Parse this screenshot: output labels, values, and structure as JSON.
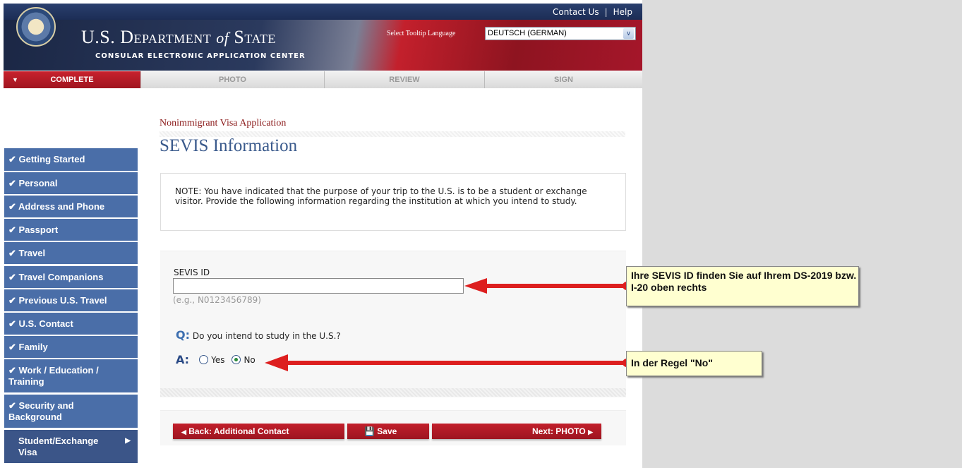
{
  "header": {
    "contact": "Contact Us",
    "help": "Help",
    "title_main": "U.S. Department",
    "title_of": "of",
    "title_state": "State",
    "subtitle": "CONSULAR ELECTRONIC APPLICATION CENTER",
    "lang_label": "Select Tooltip Language",
    "lang_value": "DEUTSCH (GERMAN)"
  },
  "nav": [
    {
      "label": "COMPLETE"
    },
    {
      "label": "PHOTO"
    },
    {
      "label": "REVIEW"
    },
    {
      "label": "SIGN"
    }
  ],
  "breadcrumb": "Nonimmigrant Visa Application",
  "page_title": "SEVIS Information",
  "sidebar": {
    "items": [
      {
        "label": "Getting Started"
      },
      {
        "label": "Personal"
      },
      {
        "label": "Address and Phone"
      },
      {
        "label": "Passport"
      },
      {
        "label": "Travel"
      },
      {
        "label": "Travel Companions"
      },
      {
        "label": "Previous U.S. Travel"
      },
      {
        "label": "U.S. Contact"
      },
      {
        "label": "Family"
      },
      {
        "label": "Work / Education / Training"
      },
      {
        "label": "Security and Background"
      },
      {
        "label": "Student/Exchange Visa"
      }
    ]
  },
  "note": "NOTE: You have indicated that the purpose of your trip to the U.S. is to be a student or exchange visitor. Provide the following information regarding the institution at which you intend to study.",
  "form": {
    "sevis_label": "SEVIS ID",
    "sevis_value": "",
    "sevis_hint": "(e.g., N0123456789)",
    "q_prefix": "Q:",
    "question": "Do you intend to study in the U.S.?",
    "a_prefix": "A:",
    "yes": "Yes",
    "no": "No",
    "selected": "No"
  },
  "buttons": {
    "back": "Back: Additional Contact",
    "save": "Save",
    "next": "Next: PHOTO"
  },
  "callouts": {
    "sevis": "Ihre SEVIS ID finden Sie auf Ihrem DS-2019 bzw. I-20 oben rechts",
    "study": "In der Regel \"No\""
  },
  "colors": {
    "accent_red": "#b01b26",
    "sidebar_blue": "#4a6ea8",
    "callout_bg": "#ffffd0"
  }
}
